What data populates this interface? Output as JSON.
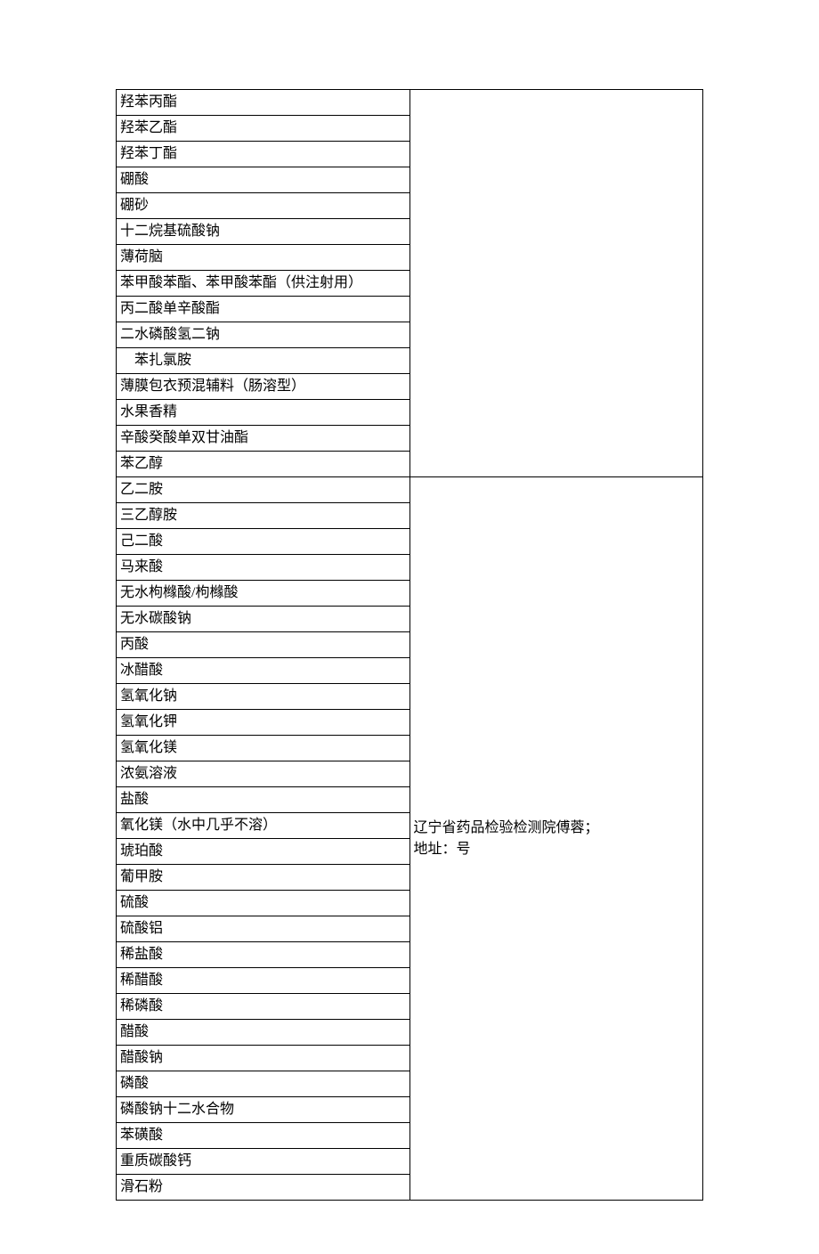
{
  "group1": {
    "items": [
      "羟苯丙酯",
      "羟苯乙酯",
      "羟苯丁酯",
      "硼酸",
      "硼砂",
      "十二烷基硫酸钠",
      "薄荷脑",
      "苯甲酸苯酯、苯甲酸苯酯（供注射用）",
      "丙二酸单辛酸酯",
      "二水磷酸氢二钠",
      "　苯扎氯胺",
      "薄膜包衣预混辅料（肠溶型）",
      "水果香精",
      "辛酸癸酸单双甘油酯",
      "苯乙醇"
    ],
    "right": ""
  },
  "group2": {
    "items": [
      "乙二胺",
      "三乙醇胺",
      "己二酸",
      "马来酸",
      "无水枸橼酸/枸橼酸",
      "无水碳酸钠",
      "丙酸",
      "冰醋酸",
      "氢氧化钠",
      "氢氧化钾",
      "氢氧化镁",
      "浓氨溶液",
      "盐酸",
      "氧化镁（水中几乎不溶）",
      "琥珀酸",
      "葡甲胺",
      "硫酸",
      "硫酸铝",
      "稀盐酸",
      "稀醋酸",
      "稀磷酸",
      "醋酸",
      "醋酸钠",
      "磷酸",
      "磷酸钠十二水合物",
      "苯磺酸",
      "重质碳酸钙",
      "滑石粉"
    ],
    "right_line1": "辽宁省药品检验检测院傅蓉；",
    "right_line2": "地址：号"
  }
}
